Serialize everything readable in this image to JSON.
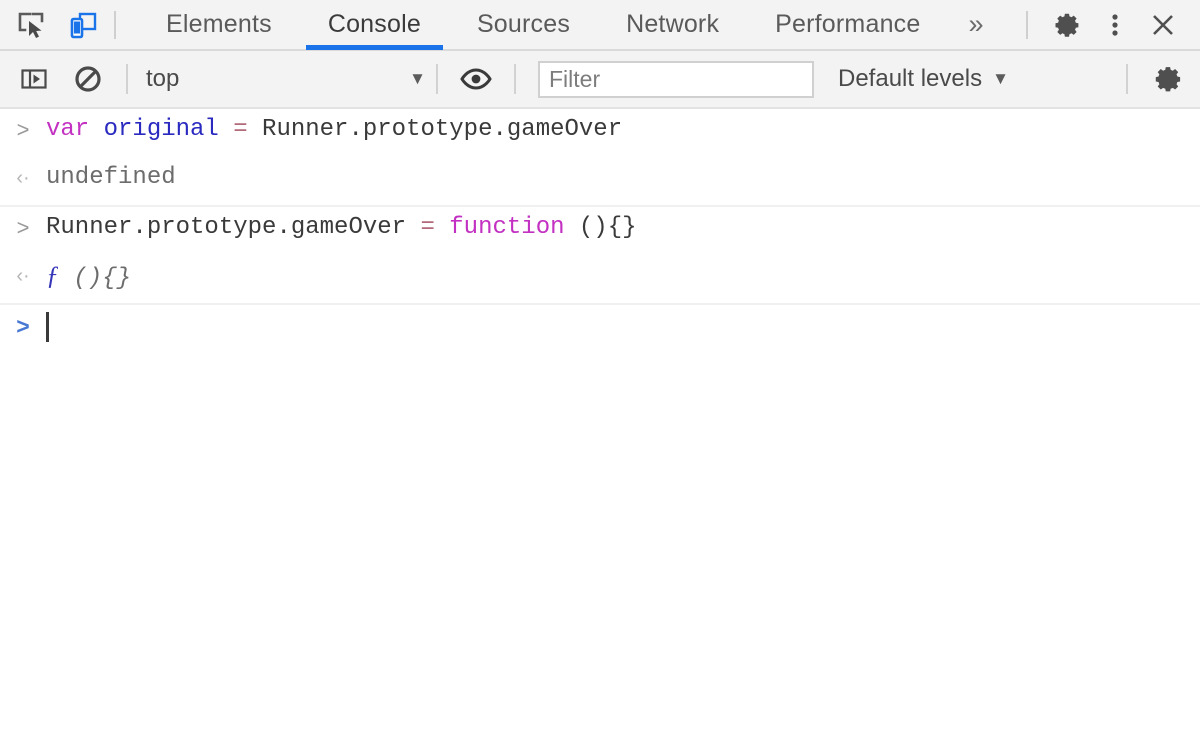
{
  "tabbar": {
    "icons": [
      {
        "name": "inspect-element-icon",
        "label": "Inspect element"
      },
      {
        "name": "device-toolbar-icon",
        "label": "Toggle device toolbar"
      }
    ],
    "tabs": [
      {
        "label": "Elements",
        "active": false
      },
      {
        "label": "Console",
        "active": true
      },
      {
        "label": "Sources",
        "active": false
      },
      {
        "label": "Network",
        "active": false
      },
      {
        "label": "Performance",
        "active": false
      }
    ],
    "more_label": "»",
    "right_buttons": [
      {
        "name": "settings-gear-icon",
        "label": "Settings"
      },
      {
        "name": "more-options-icon",
        "label": "Customize and control DevTools"
      },
      {
        "name": "close-devtools-icon",
        "label": "Close"
      }
    ],
    "accent_color": "#1a73e8"
  },
  "toolbar": {
    "sidebar_toggle": "console-sidebar-icon",
    "clear_console": "clear-console-icon",
    "context": {
      "value": "top",
      "arrow": "▼"
    },
    "live_expression": "eye-icon",
    "filter": {
      "value": "",
      "placeholder": "Filter"
    },
    "levels": {
      "value": "Default levels",
      "arrow": "▼"
    },
    "settings": "console-settings-gear-icon"
  },
  "console": {
    "messages": [
      {
        "type": "input",
        "gutter": ">",
        "tokens": [
          {
            "text": "var ",
            "style": "keyword"
          },
          {
            "text": "original",
            "style": "ident"
          },
          {
            "text": " = ",
            "style": "operator"
          },
          {
            "text": "Runner.prototype.gameOver",
            "style": "plain"
          }
        ]
      },
      {
        "type": "output",
        "gutter": "‹·",
        "group_end": true,
        "tokens": [
          {
            "text": "undefined",
            "style": "undef"
          }
        ]
      },
      {
        "type": "input",
        "gutter": ">",
        "tokens": [
          {
            "text": "Runner.prototype.gameOver",
            "style": "plain"
          },
          {
            "text": " = ",
            "style": "operator"
          },
          {
            "text": "function",
            "style": "keyword"
          },
          {
            "text": " (){}",
            "style": "plain"
          }
        ]
      },
      {
        "type": "output",
        "gutter": "‹·",
        "group_end": true,
        "tokens": [
          {
            "text": "ƒ",
            "style": "fn-glyph"
          },
          {
            "text": " (){}",
            "style": "fn-body"
          }
        ]
      }
    ],
    "prompt": {
      "gutter": ">",
      "value": ""
    }
  }
}
